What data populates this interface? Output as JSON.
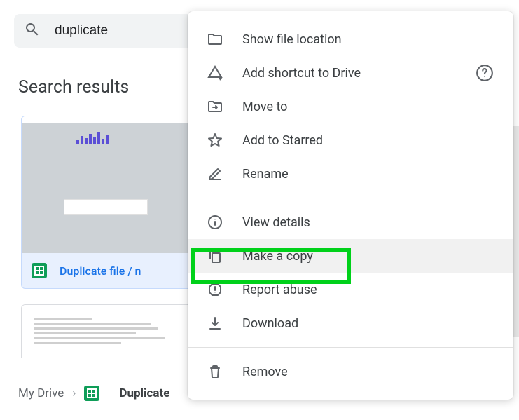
{
  "search": {
    "value": "duplicate"
  },
  "heading": "Search results",
  "file1": {
    "name": "Duplicate file / n"
  },
  "breadcrumb": {
    "root": "My Drive",
    "current": "Duplicate"
  },
  "menu": {
    "show_location": "Show file location",
    "add_shortcut": "Add shortcut to Drive",
    "move_to": "Move to",
    "add_starred": "Add to Starred",
    "rename": "Rename",
    "view_details": "View details",
    "make_copy": "Make a copy",
    "report_abuse": "Report abuse",
    "download": "Download",
    "remove": "Remove"
  }
}
